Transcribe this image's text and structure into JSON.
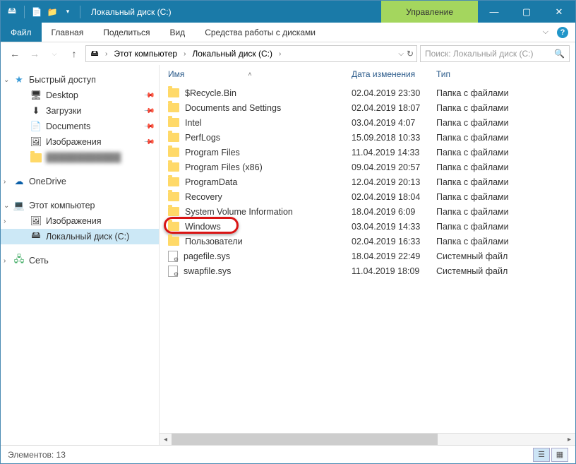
{
  "titlebar": {
    "title": "Локальный диск (C:)",
    "manage": "Управление"
  },
  "tabs": {
    "file": "Файл",
    "home": "Главная",
    "share": "Поделиться",
    "view": "Вид",
    "diskTools": "Средства работы с дисками"
  },
  "breadcrumb": {
    "seg1": "Этот компьютер",
    "seg2": "Локальный диск (C:)"
  },
  "search": {
    "placeholder": "Поиск: Локальный диск (C:)"
  },
  "sidebar": {
    "quickAccess": "Быстрый доступ",
    "desktop": "Desktop",
    "downloads": "Загрузки",
    "documents": "Documents",
    "pictures": "Изображения",
    "hidden": "████████████",
    "onedrive": "OneDrive",
    "thisPc": "Этот компьютер",
    "picturesPc": "Изображения",
    "localDisk": "Локальный диск (C:)",
    "network": "Сеть"
  },
  "columns": {
    "name": "Имя",
    "date": "Дата изменения",
    "type": "Тип"
  },
  "files": [
    {
      "icon": "folder",
      "name": "$Recycle.Bin",
      "date": "02.04.2019 23:30",
      "type": "Папка с файлами"
    },
    {
      "icon": "folder",
      "name": "Documents and Settings",
      "date": "02.04.2019 18:07",
      "type": "Папка с файлами"
    },
    {
      "icon": "folder",
      "name": "Intel",
      "date": "03.04.2019 4:07",
      "type": "Папка с файлами"
    },
    {
      "icon": "folder",
      "name": "PerfLogs",
      "date": "15.09.2018 10:33",
      "type": "Папка с файлами"
    },
    {
      "icon": "folder",
      "name": "Program Files",
      "date": "11.04.2019 14:33",
      "type": "Папка с файлами"
    },
    {
      "icon": "folder",
      "name": "Program Files (x86)",
      "date": "09.04.2019 20:57",
      "type": "Папка с файлами"
    },
    {
      "icon": "folder",
      "name": "ProgramData",
      "date": "12.04.2019 20:13",
      "type": "Папка с файлами"
    },
    {
      "icon": "folder",
      "name": "Recovery",
      "date": "02.04.2019 18:04",
      "type": "Папка с файлами"
    },
    {
      "icon": "folder",
      "name": "System Volume Information",
      "date": "18.04.2019 6:09",
      "type": "Папка с файлами"
    },
    {
      "icon": "folder",
      "name": "Windows",
      "date": "03.04.2019 14:33",
      "type": "Папка с файлами",
      "highlighted": true
    },
    {
      "icon": "folder",
      "name": "Пользователи",
      "date": "02.04.2019 16:33",
      "type": "Папка с файлами"
    },
    {
      "icon": "sysfile",
      "name": "pagefile.sys",
      "date": "18.04.2019 22:49",
      "type": "Системный файл"
    },
    {
      "icon": "sysfile",
      "name": "swapfile.sys",
      "date": "11.04.2019 18:09",
      "type": "Системный файл"
    }
  ],
  "status": {
    "items": "Элементов: 13"
  }
}
